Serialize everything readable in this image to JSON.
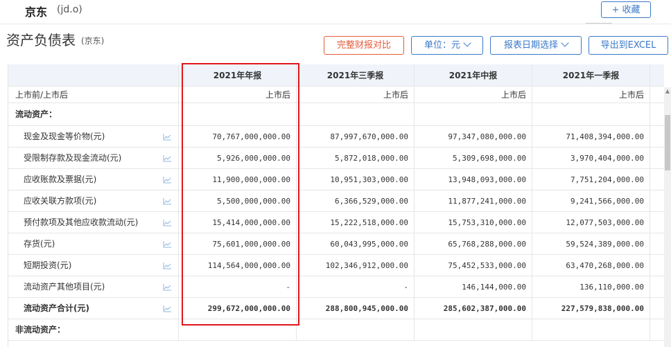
{
  "header": {
    "company": "京东",
    "ticker": "(jd.o)",
    "favorite_label": "+ 收藏"
  },
  "page": {
    "title": "资产负债表",
    "subtitle": "(京东)"
  },
  "toolbar": {
    "compare_label": "完整财报对比",
    "unit_label": "单位：元",
    "date_select_label": "报表日期选择",
    "export_label": "导出到EXCEL"
  },
  "table": {
    "columns": [
      "2021年年报",
      "2021年三季报",
      "2021年中报",
      "2021年一季报"
    ],
    "rows": [
      {
        "label": "上市前/上市后",
        "values": [
          "上市后",
          "上市后",
          "上市后",
          "上市后"
        ],
        "style": "plain",
        "icon": false
      },
      {
        "label": "流动资产：",
        "values": [
          "",
          "",
          "",
          ""
        ],
        "style": "section",
        "icon": false
      },
      {
        "label": "现金及现金等价物(元)",
        "values": [
          "70,767,000,000.00",
          "87,997,670,000.00",
          "97,347,080,000.00",
          "71,408,394,000.00"
        ],
        "style": "sub",
        "icon": true
      },
      {
        "label": "受限制存款及现金流动(元)",
        "values": [
          "5,926,000,000.00",
          "5,872,018,000.00",
          "5,309,698,000.00",
          "3,970,404,000.00"
        ],
        "style": "sub",
        "icon": true
      },
      {
        "label": "应收账款及票据(元)",
        "values": [
          "11,900,000,000.00",
          "10,951,303,000.00",
          "13,948,093,000.00",
          "7,751,204,000.00"
        ],
        "style": "sub",
        "icon": true
      },
      {
        "label": "应收关联方款项(元)",
        "values": [
          "5,500,000,000.00",
          "6,366,529,000.00",
          "11,877,241,000.00",
          "9,241,566,000.00"
        ],
        "style": "sub",
        "icon": true
      },
      {
        "label": "预付款项及其他应收款流动(元)",
        "values": [
          "15,414,000,000.00",
          "15,222,518,000.00",
          "15,753,310,000.00",
          "12,077,503,000.00"
        ],
        "style": "sub",
        "icon": true
      },
      {
        "label": "存货(元)",
        "values": [
          "75,601,000,000.00",
          "60,043,995,000.00",
          "65,768,288,000.00",
          "59,524,389,000.00"
        ],
        "style": "sub",
        "icon": true
      },
      {
        "label": "短期投资(元)",
        "values": [
          "114,564,000,000.00",
          "102,346,912,000.00",
          "75,452,533,000.00",
          "63,470,268,000.00"
        ],
        "style": "sub",
        "icon": true
      },
      {
        "label": "流动资产其他项目(元)",
        "values": [
          "-",
          "-",
          "146,144,000.00",
          "136,110,000.00"
        ],
        "style": "sub",
        "icon": true
      },
      {
        "label": "流动资产合计(元)",
        "values": [
          "299,672,000,000.00",
          "288,800,945,000.00",
          "285,602,387,000.00",
          "227,579,838,000.00"
        ],
        "style": "total",
        "icon": true
      },
      {
        "label": "非流动资产：",
        "values": [
          "",
          "",
          "",
          ""
        ],
        "style": "section",
        "icon": false
      }
    ]
  },
  "colors": {
    "accent": "#3a78c9",
    "compare": "#e35c3a",
    "highlight": "#e0151b",
    "header_bg": "#f0f4fa"
  }
}
